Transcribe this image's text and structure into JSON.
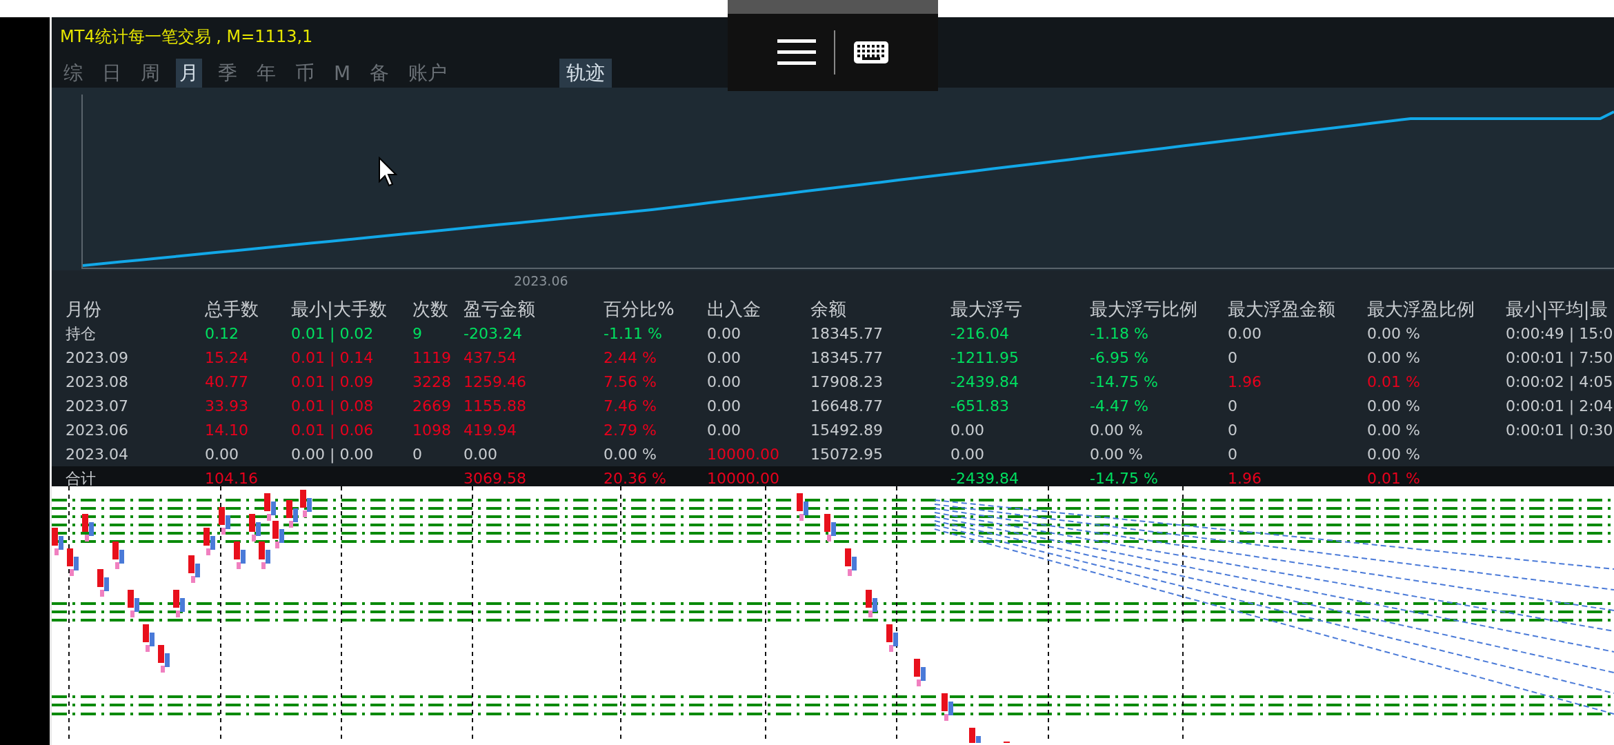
{
  "title": "MT4统计每一笔交易 , M=1113,1",
  "tabs": [
    {
      "label": "综",
      "selected": false
    },
    {
      "label": "日",
      "selected": false
    },
    {
      "label": "周",
      "selected": false
    },
    {
      "label": "月",
      "selected": true
    },
    {
      "label": "季",
      "selected": false
    },
    {
      "label": "年",
      "selected": false
    },
    {
      "label": "币",
      "selected": false
    },
    {
      "label": "M",
      "selected": false
    },
    {
      "label": "备",
      "selected": false
    },
    {
      "label": "账户",
      "selected": false
    }
  ],
  "trace_button": {
    "label": "轨迹"
  },
  "equity_chart": {
    "x_label": "2023.06"
  },
  "table": {
    "columns": [
      "月份",
      "总手数",
      "最小|大手数",
      "次数",
      "盈亏金额",
      "百分比%",
      "出入金",
      "余额",
      "最大浮亏",
      "最大浮亏比例",
      "最大浮盈金额",
      "最大浮盈比例",
      "最小|平均|最"
    ],
    "rows": [
      {
        "cells": [
          {
            "text": "持仓",
            "color": "#c8ccd0"
          },
          {
            "text": "0.12",
            "color": "#00e060"
          },
          {
            "text": "0.01 | 0.02",
            "color": "#00e060"
          },
          {
            "text": "9",
            "color": "#00e060"
          },
          {
            "text": "-203.24",
            "color": "#00e060"
          },
          {
            "text": "-1.11 %",
            "color": "#00e060"
          },
          {
            "text": "0.00",
            "color": "#c8ccd0"
          },
          {
            "text": "18345.77",
            "color": "#c8ccd0"
          },
          {
            "text": "-216.04",
            "color": "#00e060"
          },
          {
            "text": "-1.18 %",
            "color": "#00e060"
          },
          {
            "text": "0.00",
            "color": "#c8ccd0"
          },
          {
            "text": "0.00 %",
            "color": "#c8ccd0"
          },
          {
            "text": "0:00:49 | 15:0",
            "color": "#c8ccd0"
          }
        ]
      },
      {
        "cells": [
          {
            "text": "2023.09",
            "color": "#c8ccd0"
          },
          {
            "text": "15.24",
            "color": "#e8001c"
          },
          {
            "text": "0.01 | 0.14",
            "color": "#e8001c"
          },
          {
            "text": "1119",
            "color": "#e8001c"
          },
          {
            "text": "437.54",
            "color": "#e8001c"
          },
          {
            "text": "2.44 %",
            "color": "#e8001c"
          },
          {
            "text": "0.00",
            "color": "#c8ccd0"
          },
          {
            "text": "18345.77",
            "color": "#c8ccd0"
          },
          {
            "text": "-1211.95",
            "color": "#00e060"
          },
          {
            "text": "-6.95 %",
            "color": "#00e060"
          },
          {
            "text": "0",
            "color": "#c8ccd0"
          },
          {
            "text": "0.00 %",
            "color": "#c8ccd0"
          },
          {
            "text": "0:00:01 | 7:50",
            "color": "#c8ccd0"
          }
        ]
      },
      {
        "cells": [
          {
            "text": "2023.08",
            "color": "#c8ccd0"
          },
          {
            "text": "40.77",
            "color": "#e8001c"
          },
          {
            "text": "0.01 | 0.09",
            "color": "#e8001c"
          },
          {
            "text": "3228",
            "color": "#e8001c"
          },
          {
            "text": "1259.46",
            "color": "#e8001c"
          },
          {
            "text": "7.56 %",
            "color": "#e8001c"
          },
          {
            "text": "0.00",
            "color": "#c8ccd0"
          },
          {
            "text": "17908.23",
            "color": "#c8ccd0"
          },
          {
            "text": "-2439.84",
            "color": "#00e060"
          },
          {
            "text": "-14.75 %",
            "color": "#00e060"
          },
          {
            "text": "1.96",
            "color": "#e8001c"
          },
          {
            "text": "0.01 %",
            "color": "#e8001c"
          },
          {
            "text": "0:00:02 | 4:05",
            "color": "#c8ccd0"
          }
        ]
      },
      {
        "cells": [
          {
            "text": "2023.07",
            "color": "#c8ccd0"
          },
          {
            "text": "33.93",
            "color": "#e8001c"
          },
          {
            "text": "0.01 | 0.08",
            "color": "#e8001c"
          },
          {
            "text": "2669",
            "color": "#e8001c"
          },
          {
            "text": "1155.88",
            "color": "#e8001c"
          },
          {
            "text": "7.46 %",
            "color": "#e8001c"
          },
          {
            "text": "0.00",
            "color": "#c8ccd0"
          },
          {
            "text": "16648.77",
            "color": "#c8ccd0"
          },
          {
            "text": "-651.83",
            "color": "#00e060"
          },
          {
            "text": "-4.47 %",
            "color": "#00e060"
          },
          {
            "text": "0",
            "color": "#c8ccd0"
          },
          {
            "text": "0.00 %",
            "color": "#c8ccd0"
          },
          {
            "text": "0:00:01 | 2:04",
            "color": "#c8ccd0"
          }
        ]
      },
      {
        "cells": [
          {
            "text": "2023.06",
            "color": "#c8ccd0"
          },
          {
            "text": "14.10",
            "color": "#e8001c"
          },
          {
            "text": "0.01 | 0.06",
            "color": "#e8001c"
          },
          {
            "text": "1098",
            "color": "#e8001c"
          },
          {
            "text": "419.94",
            "color": "#e8001c"
          },
          {
            "text": "2.79 %",
            "color": "#e8001c"
          },
          {
            "text": "0.00",
            "color": "#c8ccd0"
          },
          {
            "text": "15492.89",
            "color": "#c8ccd0"
          },
          {
            "text": "0.00",
            "color": "#c8ccd0"
          },
          {
            "text": "0.00 %",
            "color": "#c8ccd0"
          },
          {
            "text": "0",
            "color": "#c8ccd0"
          },
          {
            "text": "0.00 %",
            "color": "#c8ccd0"
          },
          {
            "text": "0:00:01 | 0:30",
            "color": "#c8ccd0"
          }
        ]
      },
      {
        "cells": [
          {
            "text": "2023.04",
            "color": "#c8ccd0"
          },
          {
            "text": "0.00",
            "color": "#c8ccd0"
          },
          {
            "text": "0.00 | 0.00",
            "color": "#c8ccd0"
          },
          {
            "text": "0",
            "color": "#c8ccd0"
          },
          {
            "text": "0.00",
            "color": "#c8ccd0"
          },
          {
            "text": "0.00 %",
            "color": "#c8ccd0"
          },
          {
            "text": "10000.00",
            "color": "#e8001c"
          },
          {
            "text": "15072.95",
            "color": "#c8ccd0"
          },
          {
            "text": "0.00",
            "color": "#c8ccd0"
          },
          {
            "text": "0.00 %",
            "color": "#c8ccd0"
          },
          {
            "text": "0",
            "color": "#c8ccd0"
          },
          {
            "text": "0.00 %",
            "color": "#c8ccd0"
          },
          null
        ]
      }
    ],
    "total_row": {
      "cells": [
        {
          "text": "合计",
          "color": "#c8ccd0"
        },
        {
          "text": "104.16",
          "color": "#e8001c"
        },
        null,
        null,
        {
          "text": "3069.58",
          "color": "#e8001c"
        },
        {
          "text": "20.36 %",
          "color": "#e8001c"
        },
        {
          "text": "10000.00",
          "color": "#e8001c"
        },
        null,
        {
          "text": "-2439.84",
          "color": "#00e060"
        },
        {
          "text": "-14.75 %",
          "color": "#00e060"
        },
        {
          "text": "1.96",
          "color": "#e8001c"
        },
        {
          "text": "0.01 %",
          "color": "#e8001c"
        },
        null
      ]
    }
  }
}
